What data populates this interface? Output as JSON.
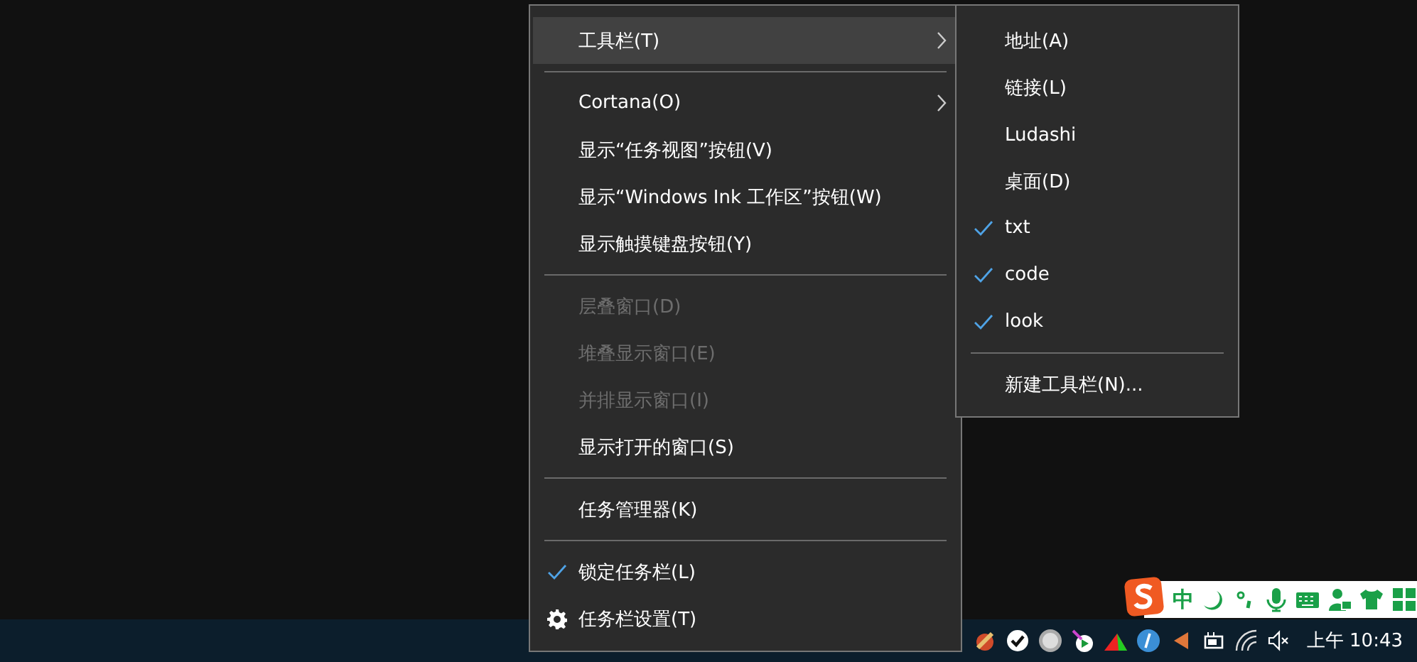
{
  "menu": {
    "items": [
      {
        "kind": "item",
        "label": "工具栏(T)",
        "highlighted": true,
        "disabled": false,
        "checked": false,
        "submenu": true
      },
      {
        "kind": "separator"
      },
      {
        "kind": "item",
        "label": "Cortana(O)",
        "highlighted": false,
        "disabled": false,
        "checked": false,
        "submenu": true
      },
      {
        "kind": "item",
        "label": "显示“任务视图”按钮(V)",
        "highlighted": false,
        "disabled": false,
        "checked": false,
        "submenu": false
      },
      {
        "kind": "item",
        "label": "显示“Windows Ink 工作区”按钮(W)",
        "highlighted": false,
        "disabled": false,
        "checked": false,
        "submenu": false
      },
      {
        "kind": "item",
        "label": "显示触摸键盘按钮(Y)",
        "highlighted": false,
        "disabled": false,
        "checked": false,
        "submenu": false
      },
      {
        "kind": "separator"
      },
      {
        "kind": "item",
        "label": "层叠窗口(D)",
        "highlighted": false,
        "disabled": true,
        "checked": false,
        "submenu": false
      },
      {
        "kind": "item",
        "label": "堆叠显示窗口(E)",
        "highlighted": false,
        "disabled": true,
        "checked": false,
        "submenu": false
      },
      {
        "kind": "item",
        "label": "并排显示窗口(I)",
        "highlighted": false,
        "disabled": true,
        "checked": false,
        "submenu": false
      },
      {
        "kind": "item",
        "label": "显示打开的窗口(S)",
        "highlighted": false,
        "disabled": false,
        "checked": false,
        "submenu": false
      },
      {
        "kind": "separator"
      },
      {
        "kind": "item",
        "label": "任务管理器(K)",
        "highlighted": false,
        "disabled": false,
        "checked": false,
        "submenu": false
      },
      {
        "kind": "separator"
      },
      {
        "kind": "item",
        "label": "锁定任务栏(L)",
        "highlighted": false,
        "disabled": false,
        "checked": true,
        "submenu": false
      },
      {
        "kind": "settings",
        "label": "任务栏设置(T)",
        "highlighted": false,
        "disabled": false,
        "checked": false,
        "submenu": false
      }
    ]
  },
  "toolbar_submenu": {
    "items": [
      {
        "kind": "item",
        "label": "地址(A)",
        "checked": false
      },
      {
        "kind": "item",
        "label": "链接(L)",
        "checked": false
      },
      {
        "kind": "item",
        "label": "Ludashi",
        "checked": false
      },
      {
        "kind": "item",
        "label": "桌面(D)",
        "checked": false
      },
      {
        "kind": "item",
        "label": "txt",
        "checked": true
      },
      {
        "kind": "item",
        "label": "code",
        "checked": true
      },
      {
        "kind": "item",
        "label": "look",
        "checked": true
      },
      {
        "kind": "separator"
      },
      {
        "kind": "item",
        "label": "新建工具栏(N)...",
        "checked": false
      }
    ]
  },
  "ime_bar": {
    "mode": "中"
  },
  "tray": {
    "clock": "上午 10:43"
  }
}
